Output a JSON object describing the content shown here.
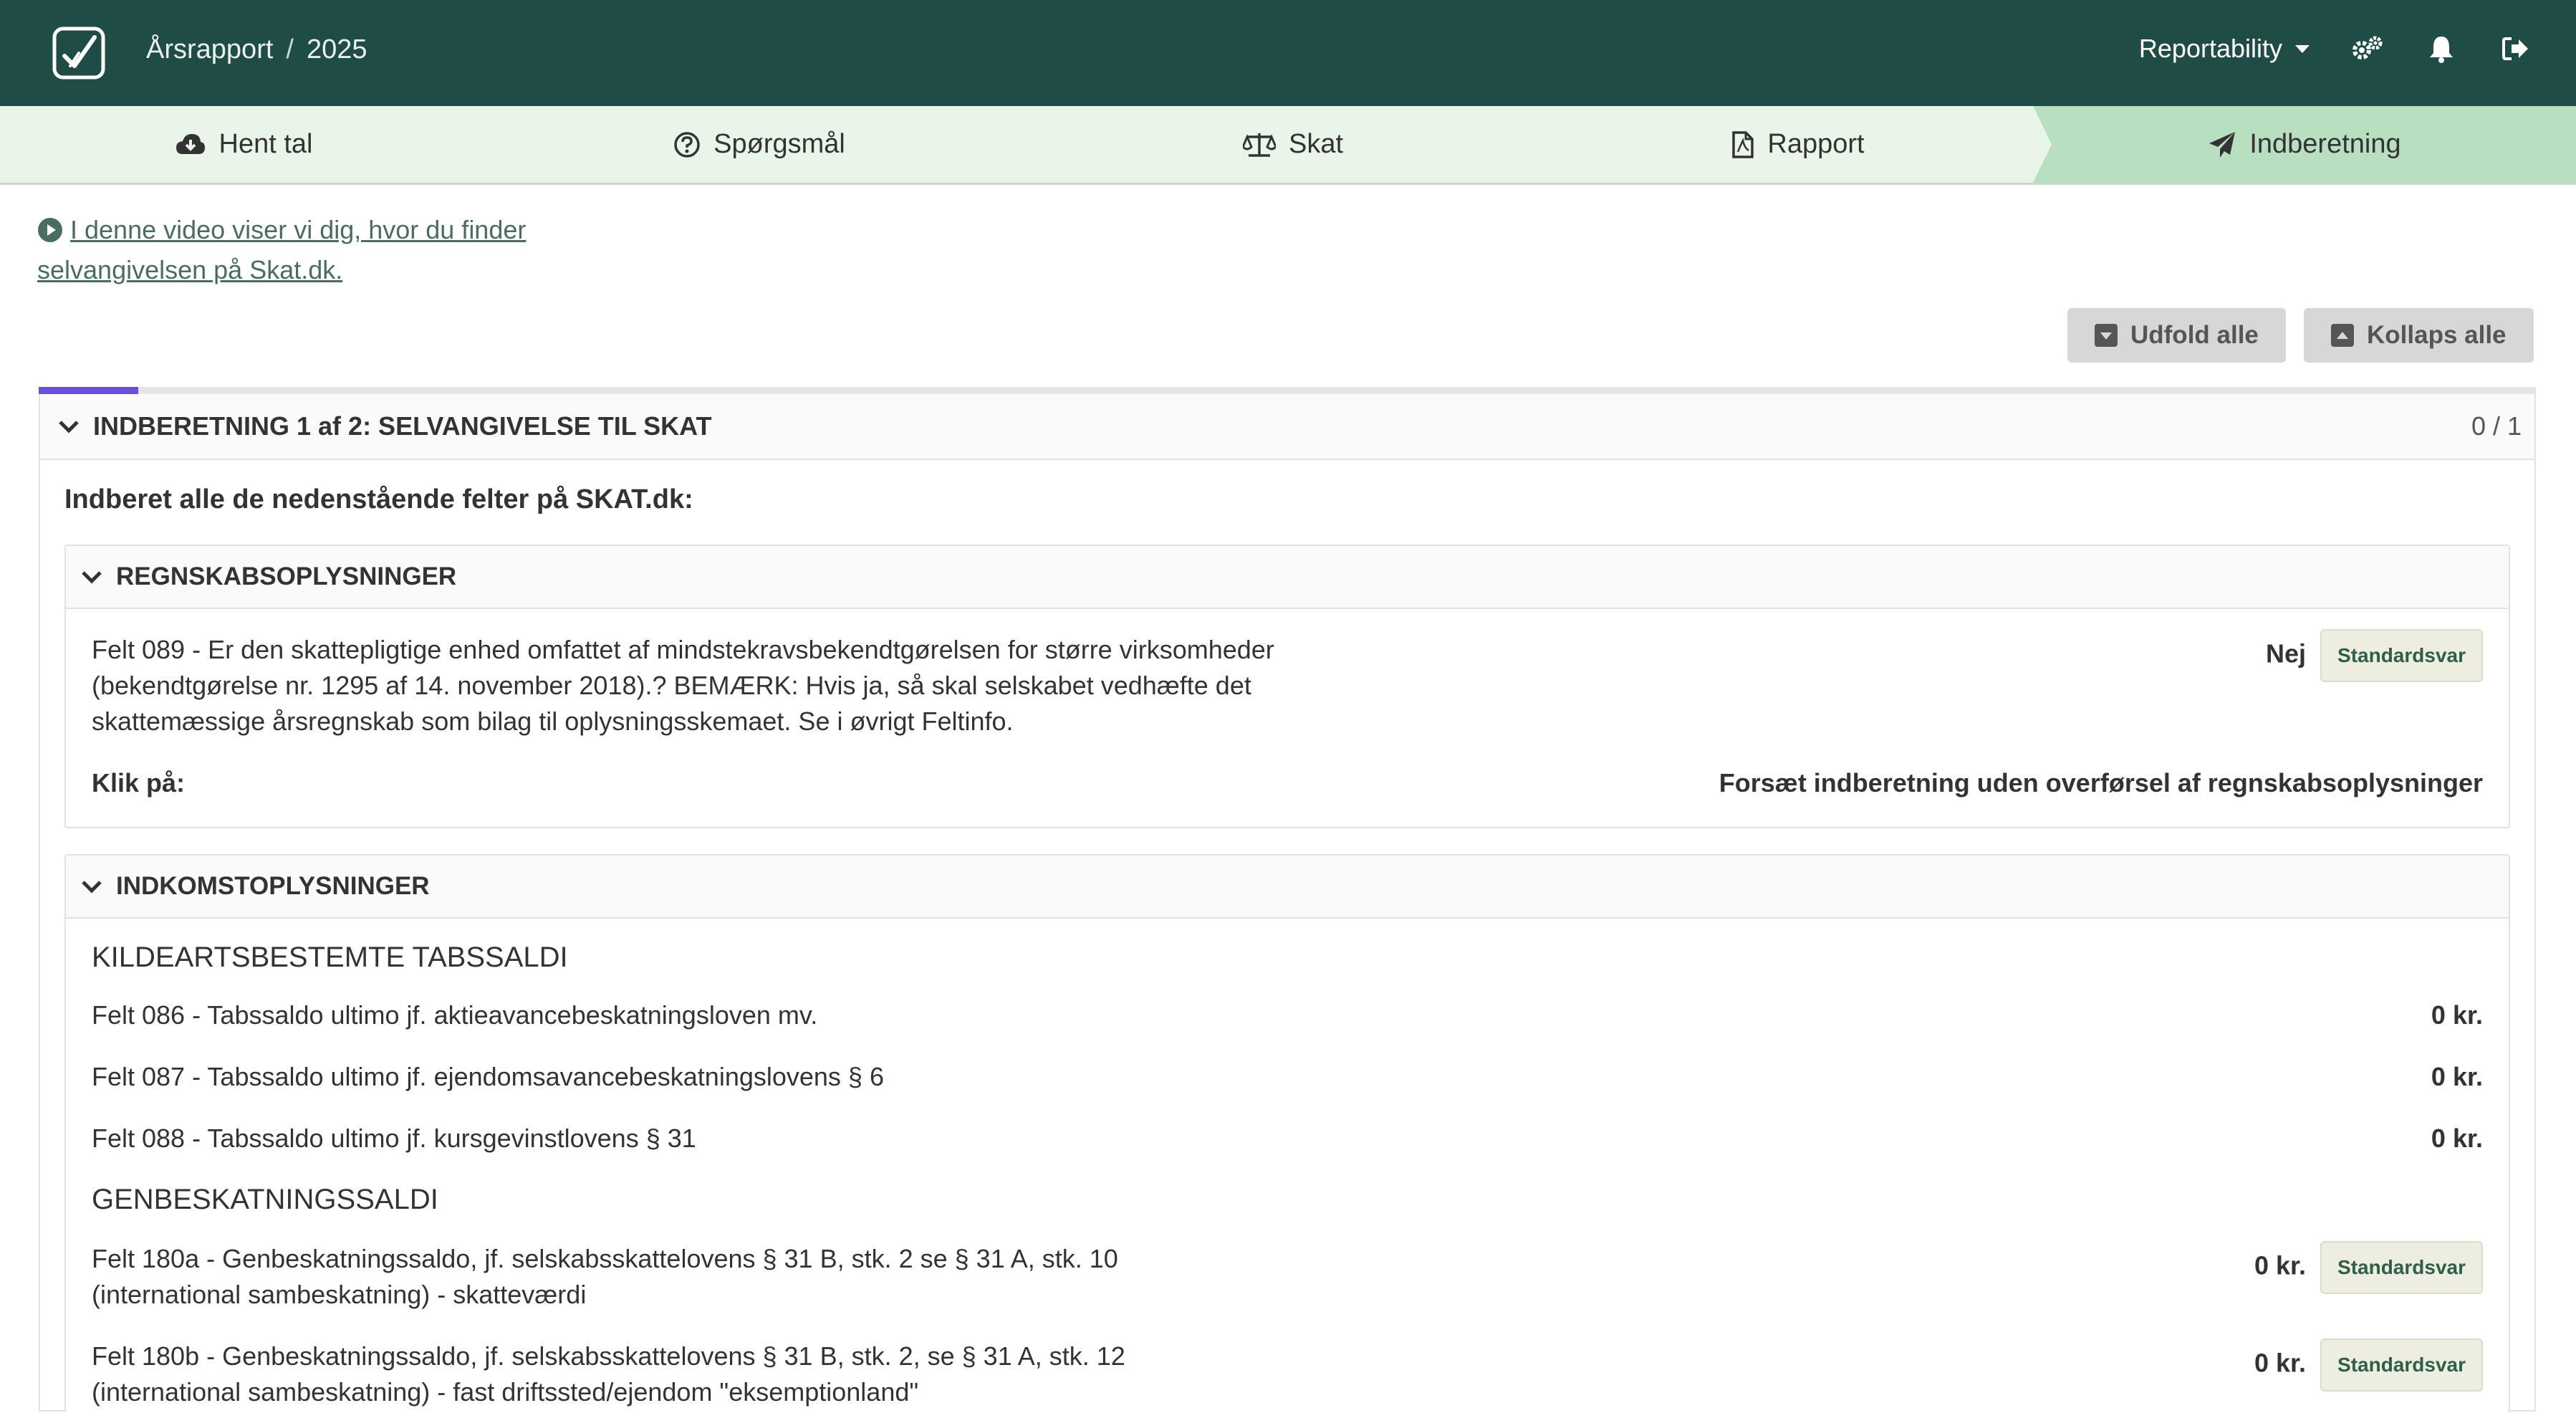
{
  "header": {
    "breadcrumb": [
      "Årsrapport",
      "2025"
    ],
    "org_name": "Reportability",
    "icons": [
      "logo-check-icon",
      "cogs-icon",
      "bell-icon",
      "sign-out-icon"
    ]
  },
  "steps": [
    {
      "label": "Hent tal",
      "icon": "cloud-download-icon"
    },
    {
      "label": "Spørgsmål",
      "icon": "question-circle-icon"
    },
    {
      "label": "Skat",
      "icon": "balance-scale-icon"
    },
    {
      "label": "Rapport",
      "icon": "file-pdf-icon"
    },
    {
      "label": "Indberetning",
      "icon": "paper-plane-icon",
      "active": true
    }
  ],
  "video_link": "I denne video viser vi dig, hvor du finder selvangivelsen på Skat.dk.",
  "buttons": {
    "expand": "Udfold alle",
    "collapse": "Kollaps alle"
  },
  "panel": {
    "title": "INDBERETNING 1 af 2: SELVANGIVELSE TIL SKAT",
    "count": "0 / 1",
    "progress": 0.04,
    "intro": "Indberet alle de nedenstående felter på SKAT.dk:",
    "sections": [
      {
        "title": "REGNSKABSOPLYSNINGER",
        "rows": [
          {
            "label": "Felt 089 - Er den skattepligtige enhed omfattet af mindstekravsbekendtgørelsen for større virksomheder (bekendtgørelse nr. 1295 af 14. november 2018).? BEMÆRK: Hvis ja, så skal selskabet vedhæfte det skattemæssige årsregnskab som bilag til oplysningsskemaet. Se i øvrigt Feltinfo.",
            "value": "Nej",
            "badge": "Standardsvar"
          },
          {
            "label": "Klik på:",
            "value": "Forsæt indberetning uden overførsel af regnskabsoplysninger"
          }
        ]
      },
      {
        "title": "INDKOMSTOPLYSNINGER",
        "subsections": [
          {
            "title": "KILDEARTSBESTEMTE TABSSALDI",
            "rows": [
              {
                "label": "Felt 086 - Tabssaldo ultimo jf. aktieavancebeskatningsloven mv.",
                "value": "0 kr."
              },
              {
                "label": "Felt 087 - Tabssaldo ultimo jf. ejendomsavancebeskatningslovens § 6",
                "value": "0 kr."
              },
              {
                "label": "Felt 088 - Tabssaldo ultimo jf. kursgevinstlovens § 31",
                "value": "0 kr."
              }
            ]
          },
          {
            "title": "GENBESKATNINGSSALDI",
            "rows": [
              {
                "label": "Felt 180a - Genbeskatningssaldo, jf. selskabsskattelovens § 31 B, stk. 2 se § 31 A, stk. 10 (international sambeskatning) - skatteværdi",
                "value": "0 kr.",
                "badge": "Standardsvar"
              },
              {
                "label": "Felt 180b - Genbeskatningssaldo, jf. selskabsskattelovens § 31 B, stk. 2, se § 31 A, stk. 12 (international sambeskatning) - fast driftssted/ejendom \"eksemptionland\"",
                "value": "0 kr.",
                "badge": "Standardsvar"
              }
            ]
          }
        ]
      }
    ]
  }
}
